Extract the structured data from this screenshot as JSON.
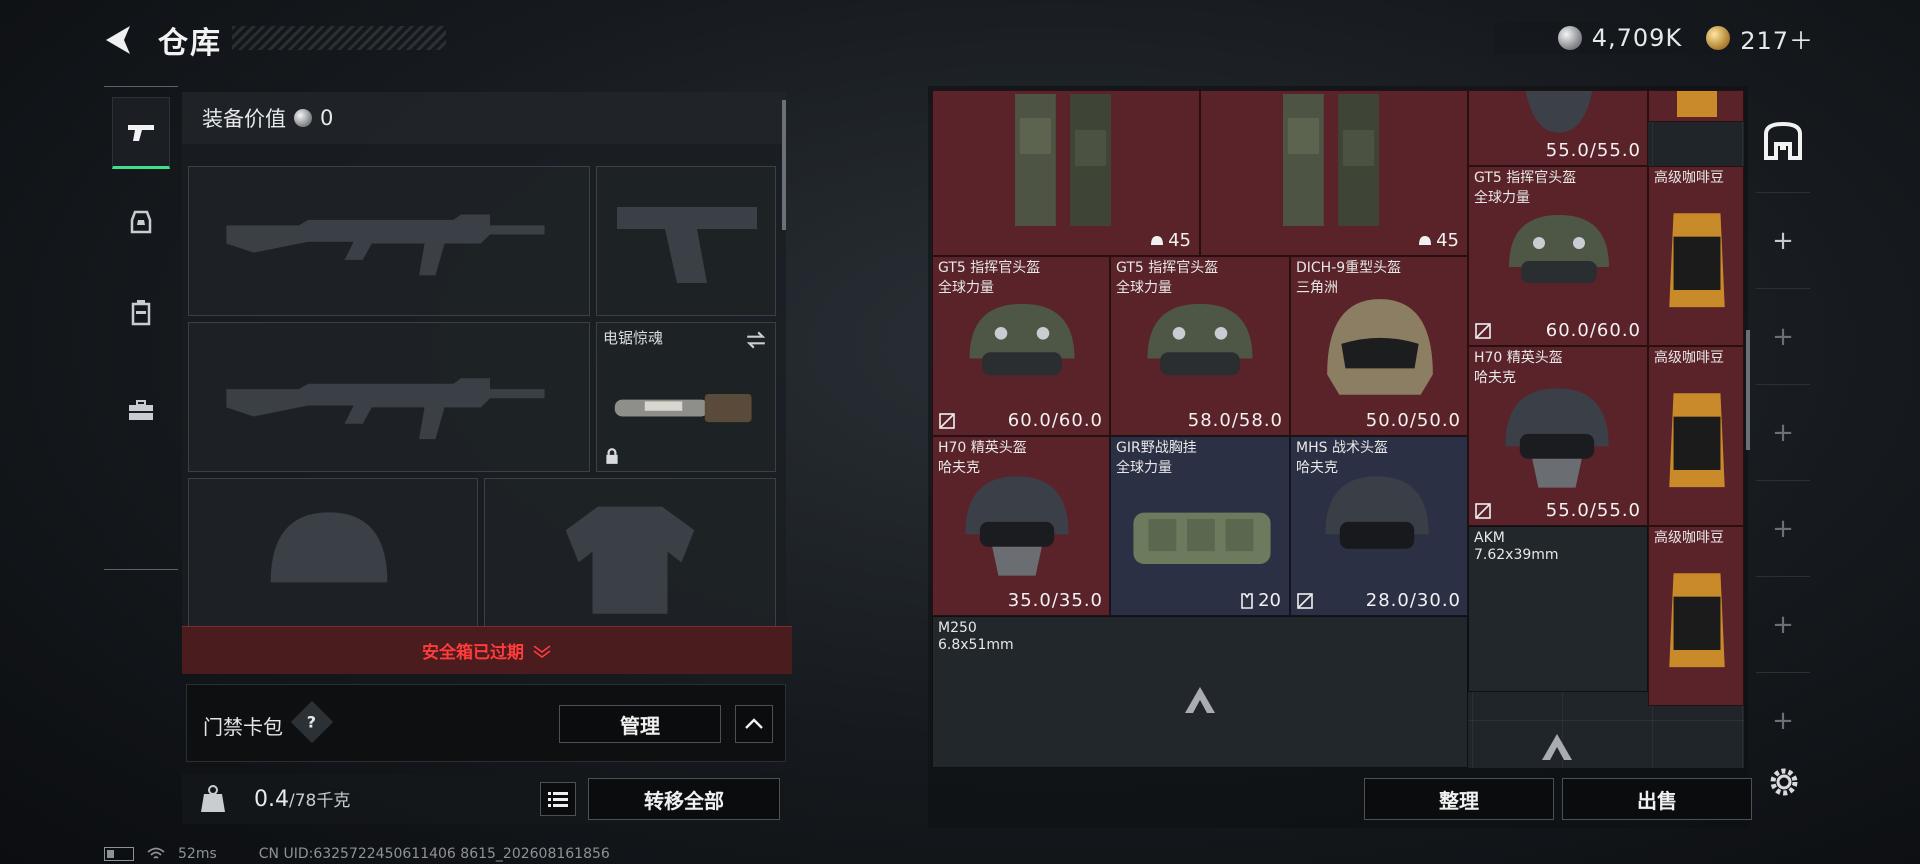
{
  "header": {
    "title": "仓库"
  },
  "currency": {
    "silver": "4,709K",
    "gold": "217＋"
  },
  "nav": {
    "items": [
      "weapons-icon",
      "character-icon",
      "backpack-icon",
      "briefcase-icon"
    ]
  },
  "equipment": {
    "value_label": "装备价值",
    "value": "0",
    "melee_slot": {
      "name": "电锯惊魂"
    }
  },
  "safebox": {
    "status": "安全箱已过期"
  },
  "keycard": {
    "label": "门禁卡包",
    "help": "?",
    "manage": "管理"
  },
  "weight": {
    "current": "0.4",
    "max": "/78千克",
    "transfer_all": "转移全部"
  },
  "status_bar": {
    "ping": "52ms",
    "uid": "CN UID:6325722450611406 8615_202608161856"
  },
  "warehouse": {
    "items": [
      {
        "key": "rig1",
        "qty": "45"
      },
      {
        "key": "rig2",
        "qty": "45"
      },
      {
        "key": "helm_top",
        "durability": "55.0/55.0"
      },
      {
        "key": "gt5_r",
        "name": "GT5 指挥官头盔",
        "sub": "全球力量",
        "durability": "60.0/60.0"
      },
      {
        "key": "gt5_a",
        "name": "GT5 指挥官头盔",
        "sub": "全球力量",
        "durability": "60.0/60.0"
      },
      {
        "key": "gt5_b",
        "name": "GT5 指挥官头盔",
        "sub": "全球力量",
        "durability": "58.0/58.0"
      },
      {
        "key": "dich9",
        "name": "DICH-9重型头盔",
        "sub": "三角洲",
        "durability": "50.0/50.0"
      },
      {
        "key": "h70_r",
        "name": "H70 精英头盔",
        "sub": "哈夫克",
        "durability": "55.0/55.0"
      },
      {
        "key": "h70_l",
        "name": "H70 精英头盔",
        "sub": "哈夫克",
        "durability": "35.0/35.0"
      },
      {
        "key": "gir",
        "name": "GIR野战胸挂",
        "sub": "全球力量",
        "qty": "20"
      },
      {
        "key": "mhs",
        "name": "MHS 战术头盔",
        "sub": "哈夫克",
        "durability": "28.0/30.0"
      },
      {
        "key": "akm",
        "name": "AKM",
        "sub": "7.62x39mm"
      },
      {
        "key": "m250",
        "name": "M250",
        "sub": "6.8x51mm"
      },
      {
        "key": "coffee1",
        "name": "高级咖啡豆"
      },
      {
        "key": "coffee2",
        "name": "高级咖啡豆"
      },
      {
        "key": "coffee3",
        "name": "高级咖啡豆"
      }
    ]
  },
  "actions": {
    "sort": "整理",
    "sell": "出售"
  },
  "colors": {
    "accent_green": "#3fe089",
    "expired_red": "#ff3b3b",
    "item_red": "#5a2329",
    "item_navy": "#2c3044"
  }
}
